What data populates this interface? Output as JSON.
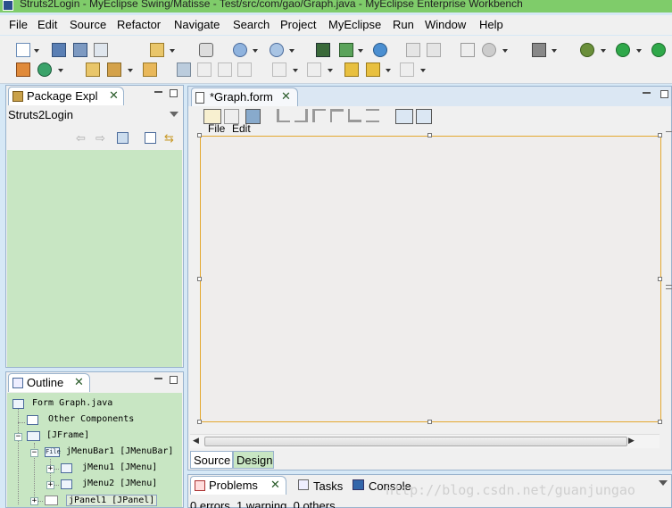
{
  "window": {
    "title": "Struts2Login - MyEclipse Swing/Matisse - Test/src/com/gao/Graph.java - MyEclipse Enterprise Workbench"
  },
  "menubar": {
    "items": [
      "File",
      "Edit",
      "Source",
      "Refactor",
      "Navigate",
      "Search",
      "Project",
      "MyEclipse",
      "Run",
      "Window",
      "Help"
    ]
  },
  "package_explorer": {
    "tab_label": "Package Expl",
    "project": "Struts2Login"
  },
  "outline": {
    "tab_label": "Outline",
    "tree": {
      "form": "Form Graph.java",
      "other": "Other Components",
      "frame": "[JFrame]",
      "menubar": "jMenuBar1 [JMenuBar]",
      "menubar_icon_text": "File",
      "menu1": "jMenu1 [JMenu]",
      "menu2": "jMenu2 [JMenu]",
      "panel": "jPanel1 [JPanel]"
    }
  },
  "editor": {
    "tab_label": "*Graph.form",
    "form_menu": [
      "File",
      "Edit"
    ],
    "bottom_tabs": [
      "Source",
      "Design"
    ],
    "active_bottom_tab": "Design"
  },
  "problems": {
    "tabs": [
      "Problems",
      "Tasks",
      "Console"
    ],
    "status": "0 errors, 1 warning, 0 others"
  },
  "watermark": "http://blog.csdn.net/guanjungao",
  "colors": {
    "title_bar": "#7fcc6a",
    "panel_green": "#c8e6c3",
    "design_border": "#e4a830"
  }
}
